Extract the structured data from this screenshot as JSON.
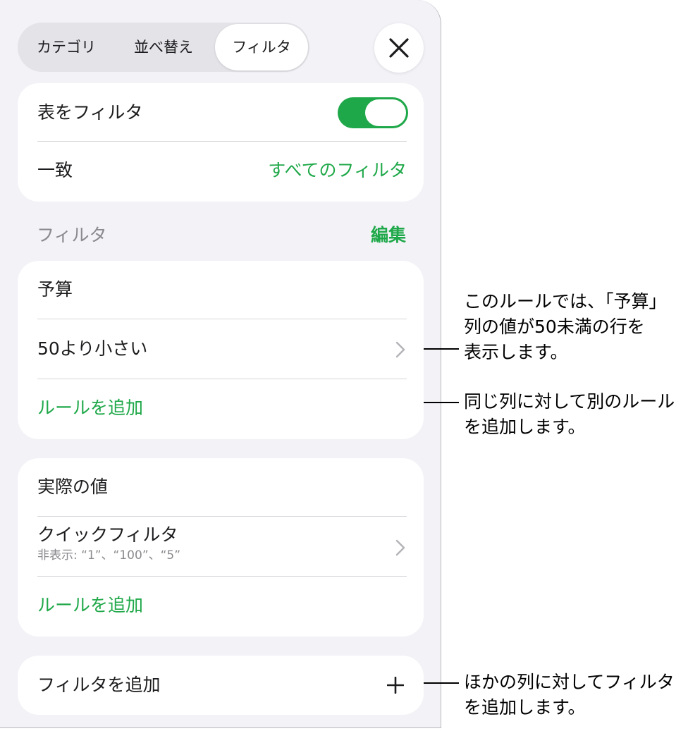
{
  "tabs": [
    {
      "label": "カテゴリ",
      "active": false
    },
    {
      "label": "並べ替え",
      "active": false
    },
    {
      "label": "フィルタ",
      "active": true
    }
  ],
  "filter_table": {
    "label": "表をフィルタ",
    "toggle_on": true,
    "match_label": "一致",
    "match_value": "すべてのフィルタ"
  },
  "filters_section": {
    "title": "フィルタ",
    "edit_label": "編集"
  },
  "filter_groups": [
    {
      "column": "予算",
      "rule": "50より小さい",
      "add_rule": "ルールを追加"
    },
    {
      "column": "実際の値",
      "rule": "クイックフィルタ",
      "rule_detail": "非表示: “1”、“100”、“5”",
      "add_rule": "ルールを追加"
    }
  ],
  "add_filter": {
    "label": "フィルタを追加",
    "icon": "plus-icon"
  },
  "callouts": {
    "rule_info": [
      "このルールでは、「予算」",
      "列の値が50未満の行を",
      "表示します。"
    ],
    "add_rule_info": [
      "同じ列に対して別のルール",
      "を追加します。"
    ],
    "add_filter_info": [
      "ほかの列に対してフィルタ",
      "を追加します。"
    ]
  },
  "colors": {
    "accent": "#1fa849",
    "panel_bg": "#f2f2f7",
    "card_bg": "#ffffff"
  }
}
